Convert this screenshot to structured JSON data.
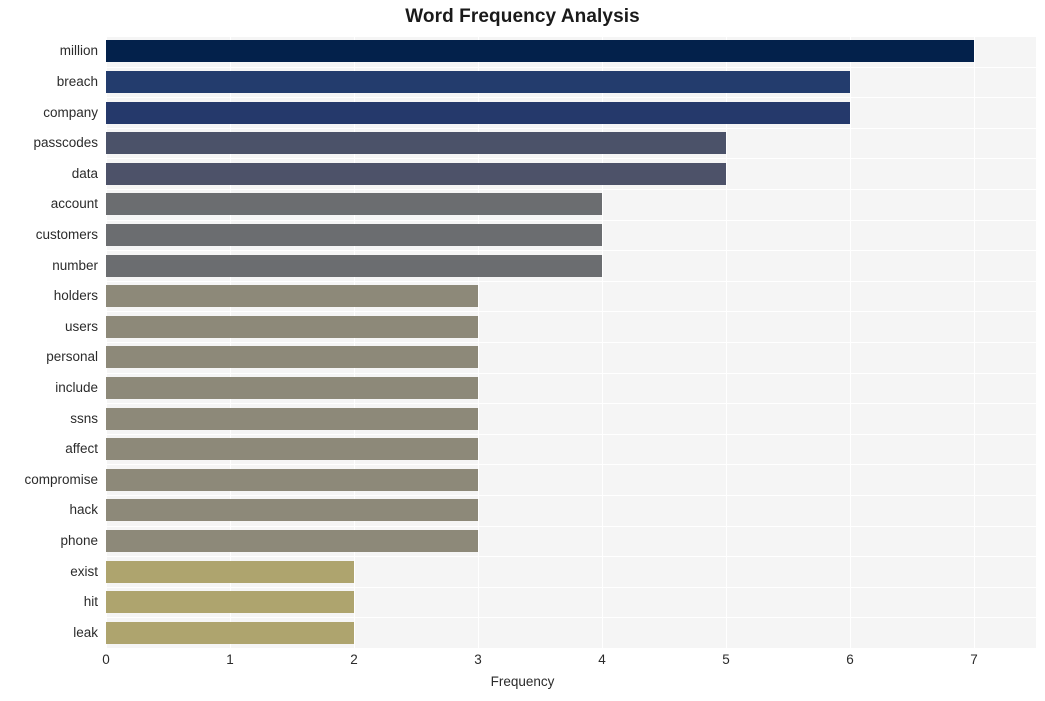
{
  "chart_data": {
    "type": "bar",
    "orientation": "horizontal",
    "title": "Word Frequency Analysis",
    "xlabel": "Frequency",
    "ylabel": "",
    "xlim": [
      0,
      7.5
    ],
    "xticks": [
      "0",
      "1",
      "2",
      "3",
      "4",
      "5",
      "6",
      "7"
    ],
    "xtick_values": [
      0,
      1,
      2,
      3,
      4,
      5,
      6,
      7
    ],
    "grid": true,
    "legend": "none",
    "categories": [
      "million",
      "breach",
      "company",
      "passcodes",
      "data",
      "account",
      "customers",
      "number",
      "holders",
      "users",
      "personal",
      "include",
      "ssns",
      "affect",
      "compromise",
      "hack",
      "phone",
      "exist",
      "hit",
      "leak"
    ],
    "values": [
      7,
      6,
      6,
      5,
      5,
      4,
      4,
      4,
      3,
      3,
      3,
      3,
      3,
      3,
      3,
      3,
      3,
      2,
      2,
      2
    ],
    "bar_colors": [
      "#03214b",
      "#233c6d",
      "#25396b",
      "#4b5269",
      "#4d5269",
      "#6b6d70",
      "#6b6d70",
      "#6b6d70",
      "#8d8979",
      "#8d8979",
      "#8d8979",
      "#8d8979",
      "#8d8979",
      "#8d8979",
      "#8d8979",
      "#8d8979",
      "#8d8979",
      "#aea46e",
      "#aea46e",
      "#aea46e"
    ],
    "plot_background": "#f5f5f5",
    "grid_color": "#ffffff",
    "figure_background": "#ffffff"
  }
}
